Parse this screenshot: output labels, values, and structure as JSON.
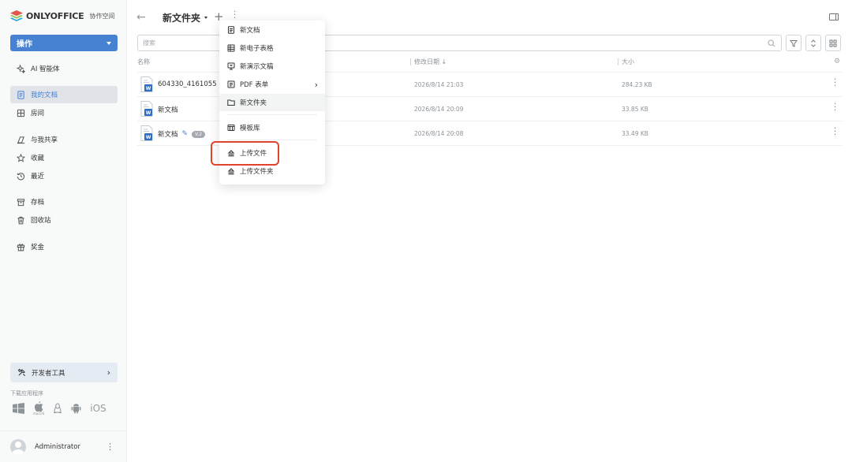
{
  "brand": {
    "name": "ONLYOFFICE",
    "subtitle": "协作空间"
  },
  "sidebar": {
    "action_label": "操作",
    "items": [
      {
        "label": "AI 智能体",
        "icon": "ai-agent-icon"
      },
      {
        "label": "我的文档",
        "icon": "document-icon",
        "active": true
      },
      {
        "label": "房间",
        "icon": "rooms-icon"
      },
      {
        "label": "与我共享",
        "icon": "shared-icon"
      },
      {
        "label": "收藏",
        "icon": "star-icon"
      },
      {
        "label": "最近",
        "icon": "recent-icon"
      },
      {
        "label": "存档",
        "icon": "archive-icon"
      },
      {
        "label": "回收站",
        "icon": "trash-icon"
      },
      {
        "label": "奖金",
        "icon": "gift-icon"
      }
    ],
    "dev_tools_label": "开发者工具",
    "download_label": "下载应用程序",
    "apps": {
      "macos_label": "macOS",
      "ios_label": "iOS"
    },
    "user_name": "Administrator"
  },
  "header": {
    "folder_title": "新文件夹"
  },
  "search": {
    "placeholder": "搜索"
  },
  "table": {
    "columns": {
      "name": "名称",
      "modified": "修改日期",
      "size": "大小"
    },
    "rows": [
      {
        "name": "604330_4161055",
        "date": "2026/8/14 21:03",
        "size": "284.23 KB",
        "editing": true
      },
      {
        "name": "新文档",
        "date": "2026/8/14 20:09",
        "size": "33.85 KB"
      },
      {
        "name": "新文档",
        "date": "2026/8/14 20:08",
        "size": "33.49 KB",
        "editing": true,
        "version": "V.2"
      }
    ]
  },
  "menu": {
    "items": [
      {
        "label": "新文档",
        "icon": "document-icon"
      },
      {
        "label": "新电子表格",
        "icon": "spreadsheet-icon"
      },
      {
        "label": "新演示文稿",
        "icon": "presentation-icon"
      },
      {
        "label": "PDF 表单",
        "icon": "pdf-form-icon",
        "submenu": true
      },
      {
        "label": "新文件夹",
        "icon": "folder-icon",
        "hovered": true
      },
      {
        "label": "模板库",
        "icon": "templates-icon"
      },
      {
        "label": "上传文件",
        "icon": "upload-icon",
        "highlighted": true
      },
      {
        "label": "上传文件夹",
        "icon": "upload-icon"
      }
    ]
  },
  "colors": {
    "accent": "#4781d1",
    "highlight": "#e0452c",
    "sidebar_bg": "#f8f9f9"
  }
}
